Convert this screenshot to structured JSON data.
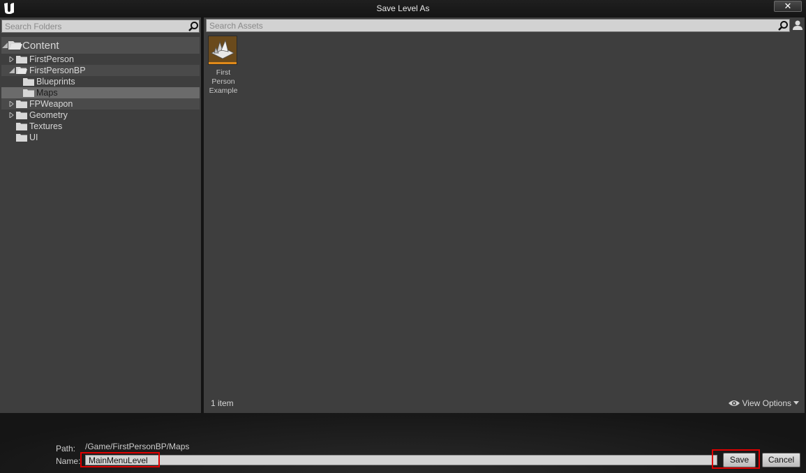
{
  "window": {
    "title": "Save Level As",
    "close_label": "✕"
  },
  "folders": {
    "search_placeholder": "Search Folders",
    "root": "Content",
    "items": [
      {
        "label": "FirstPerson"
      },
      {
        "label": "FirstPersonBP"
      },
      {
        "label": "Blueprints"
      },
      {
        "label": "Maps"
      },
      {
        "label": "FPWeapon"
      },
      {
        "label": "Geometry"
      },
      {
        "label": "Textures"
      },
      {
        "label": "UI"
      }
    ]
  },
  "assets": {
    "search_placeholder": "Search Assets",
    "items": [
      {
        "name": "First Person Example"
      }
    ],
    "count_label": "1 item",
    "view_options_label": "View Options"
  },
  "form": {
    "path_label": "Path:",
    "path_value": "/Game/FirstPersonBP/Maps",
    "name_label": "Name:",
    "name_value": "MainMenuLevel",
    "save_label": "Save",
    "cancel_label": "Cancel"
  },
  "colors": {
    "panel": "#3e3e3e",
    "highlight": "#e00000",
    "asset_accent": "#e08a1a"
  }
}
